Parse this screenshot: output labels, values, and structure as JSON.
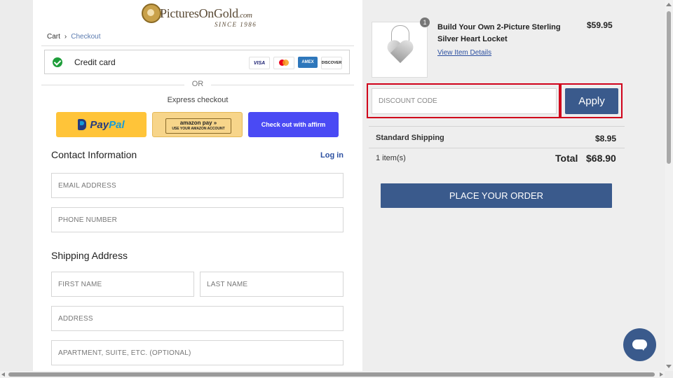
{
  "logo": {
    "name": "PicturesOnGold",
    "domain": ".com",
    "since": "SINCE 1986"
  },
  "breadcrumb": {
    "cart": "Cart",
    "current": "Checkout"
  },
  "payment": {
    "method_label": "Credit card",
    "cards": [
      "VISA",
      "MC",
      "AMEX",
      "DISCOVER"
    ]
  },
  "express": {
    "or_label": "OR",
    "title": "Express checkout",
    "paypal_a": "Pay",
    "paypal_b": "Pal",
    "amazon_top": "amazon pay  »",
    "amazon_bottom": "USE YOUR AMAZON ACCOUNT",
    "affirm": "Check out with affirm"
  },
  "contact": {
    "title": "Contact Information",
    "login": "Log in",
    "email_placeholder": "EMAIL ADDRESS",
    "phone_placeholder": "PHONE NUMBER"
  },
  "shipping": {
    "title": "Shipping Address",
    "first_placeholder": "FIRST NAME",
    "last_placeholder": "LAST NAME",
    "address_placeholder": "ADDRESS",
    "apt_placeholder": "APARTMENT, SUITE, ETC. (OPTIONAL)"
  },
  "order": {
    "product_name": "Build Your Own 2-Picture Sterling Silver Heart Locket",
    "product_link": "View Item Details",
    "product_price": "$59.95",
    "quantity": "1",
    "discount_placeholder": "DISCOUNT CODE",
    "apply_label": "Apply",
    "shipping_label": "Standard Shipping",
    "shipping_value": "$8.95",
    "items_count": "1 item(s)",
    "total_label": "Total",
    "total_value": "$68.90",
    "place_order": "PLACE YOUR ORDER"
  },
  "colors": {
    "accent": "#3a5a8c",
    "highlight": "#d0021b",
    "link": "#2b4fa0"
  }
}
